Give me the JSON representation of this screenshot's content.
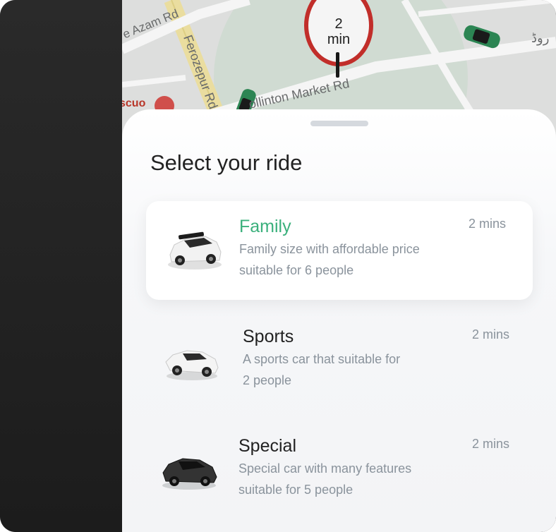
{
  "map": {
    "labels": {
      "azam_rd": "e Azam Rd",
      "ferozepur": "Ferozepur Rd",
      "collinton": "ollinton Market Rd",
      "urdu": "روڈ",
      "poi": "scuo"
    },
    "eta_pin": {
      "value": "2",
      "unit": "min"
    }
  },
  "sheet": {
    "title": "Select your ride"
  },
  "rides": [
    {
      "name": "Family",
      "desc_line1": "Family size with affordable price",
      "desc_line2": "suitable for 6 people",
      "eta": "2 mins",
      "selected": true,
      "car_color": "white"
    },
    {
      "name": "Sports",
      "desc_line1": "A sports car that suitable for",
      "desc_line2": "2 people",
      "eta": "2 mins",
      "selected": false,
      "car_color": "white"
    },
    {
      "name": "Special",
      "desc_line1": "Special car with many features",
      "desc_line2": "suitable for 5 people",
      "eta": "2 mins",
      "selected": false,
      "car_color": "black"
    }
  ],
  "colors": {
    "accent": "#3bb07c",
    "pin_ring": "#c9302c",
    "map_car": "#2e8b57"
  }
}
